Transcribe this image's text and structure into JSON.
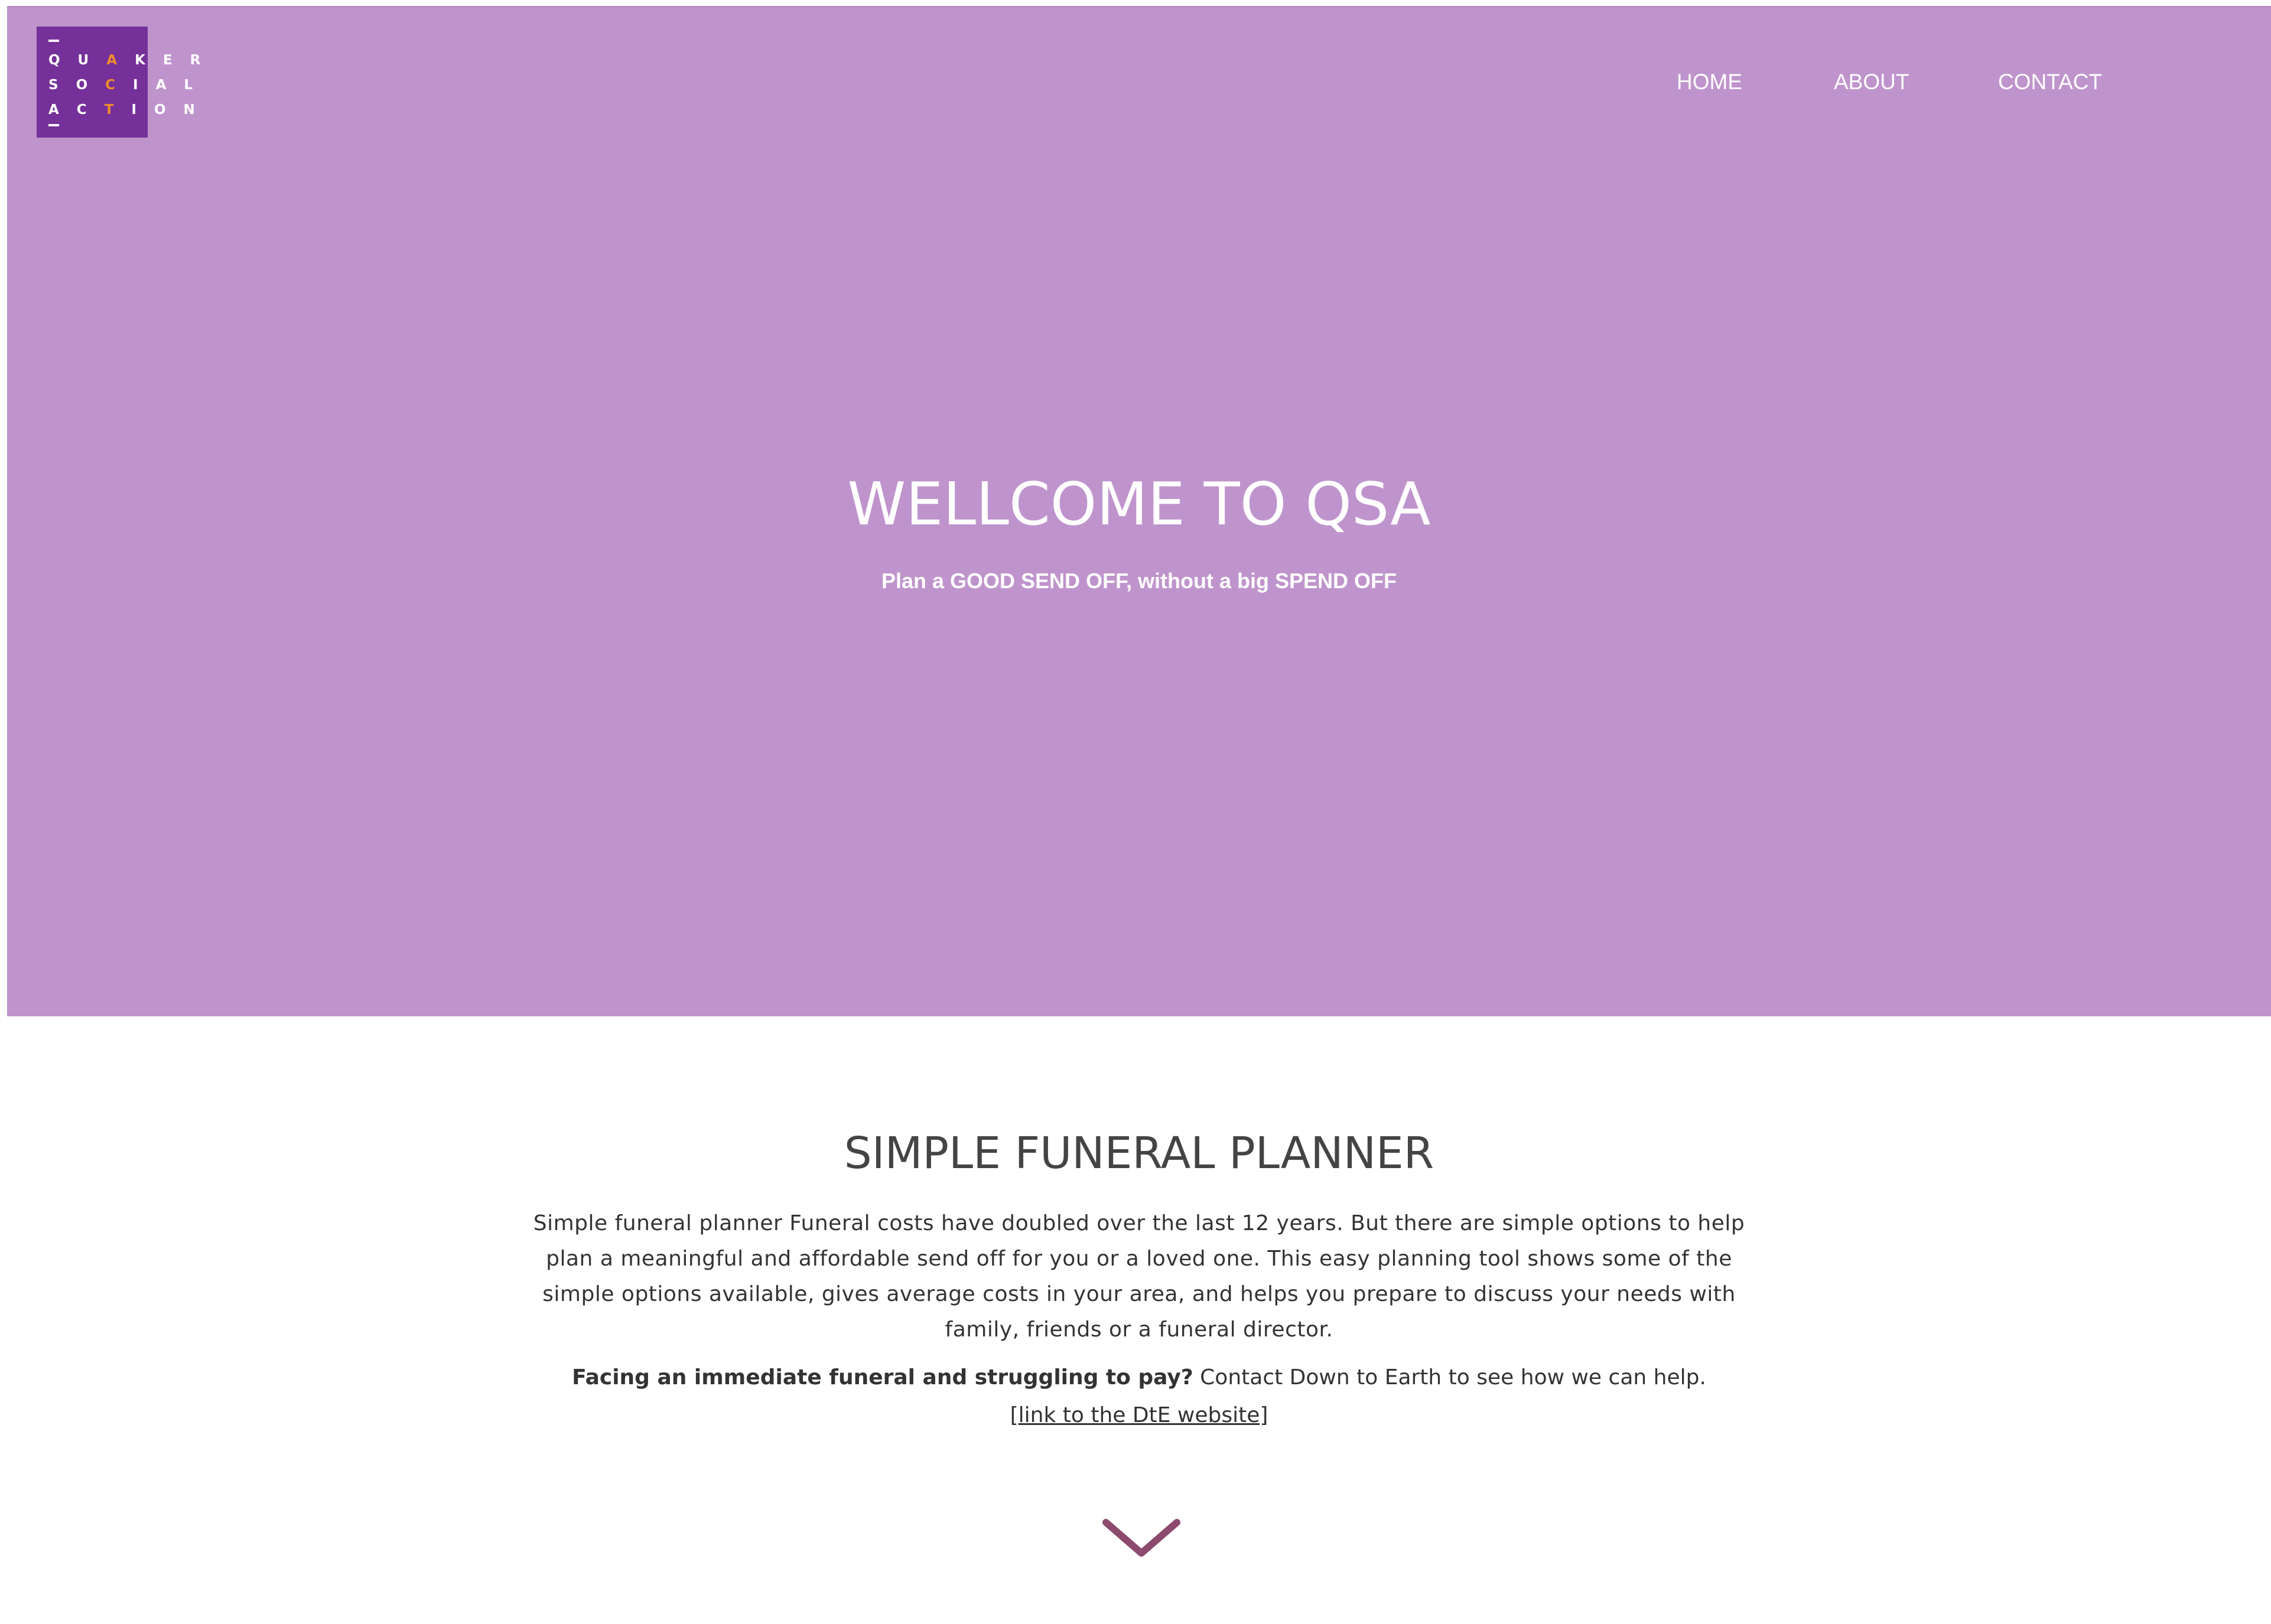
{
  "logo": {
    "lines": [
      "QUAKER",
      "SOCIAL",
      "ACTION"
    ],
    "colors": {
      "background": "#75309a",
      "accent": "#f08c2d"
    }
  },
  "nav": {
    "items": [
      {
        "label": "HOME"
      },
      {
        "label": "ABOUT"
      },
      {
        "label": "CONTACT"
      }
    ]
  },
  "hero": {
    "title": "WELLCOME TO QSA",
    "subtitle": "Plan a GOOD SEND OFF, without a big SPEND OFF",
    "background_color": "#bf94cc"
  },
  "planner": {
    "title": "SIMPLE FUNERAL PLANNER",
    "intro": "Simple funeral planner Funeral costs have doubled over the last 12 years. But there are simple options to help plan a meaningful and affordable send off for you or a loved one.  This easy planning tool shows some of the simple options available, gives average costs in your area, and helps you prepare to discuss your needs with family, friends or a funeral director.",
    "help_bold": "Facing an immediate funeral and struggling to pay?",
    "help_text": " Contact Down to Earth to see how we can help.",
    "link_text": "[link to the DtE website]",
    "scroll_icon": "chevron-down-icon",
    "chevron_color": "#8b4a6e"
  }
}
